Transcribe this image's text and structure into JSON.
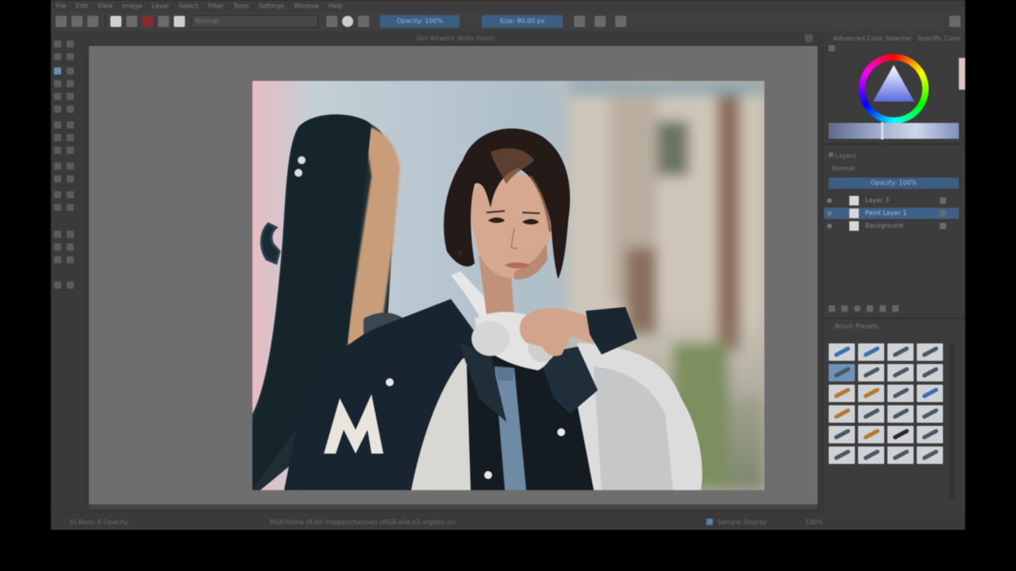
{
  "app": {
    "menu": [
      "File",
      "Edit",
      "View",
      "Image",
      "Layer",
      "Select",
      "Filter",
      "Tools",
      "Settings",
      "Window",
      "Help"
    ],
    "document_title": "Girl Artwork  (Krita Paint)",
    "toolbar": {
      "blend_mode": "Normal",
      "opacity_label": "Opacity: 100%",
      "size_label": "Size: 80.00 px"
    },
    "status": {
      "left": "b) Basic-5 Opacity",
      "center": "RGB/Alpha (8-bit integer/channel)  sRGB-elle-V2-srgbtrc.icc",
      "right_a": "Sample Display",
      "right_b": "100%"
    },
    "dock": {
      "color_tab_a": "Advanced Color Selector",
      "color_tab_b": "Specific Color",
      "layers_title": "Layers",
      "layers_blend": "Normal",
      "layers_opacity": "Opacity: 100%",
      "layers": [
        {
          "name": "Layer 3",
          "selected": false
        },
        {
          "name": "Paint Layer 1",
          "selected": true
        },
        {
          "name": "Background",
          "selected": false
        }
      ],
      "presets_title": "Brush Presets"
    },
    "colors": {
      "accent": "#3d5e83",
      "canvas_bg": "#6e6e6e",
      "panel_bg": "#3c3c3c"
    }
  }
}
